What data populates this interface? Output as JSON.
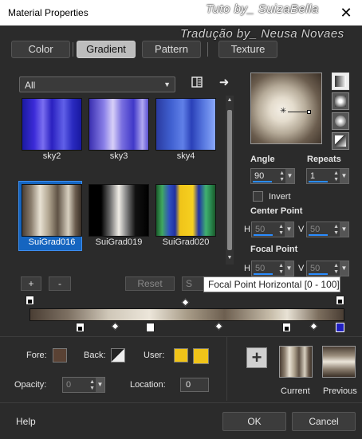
{
  "window": {
    "title": "Material Properties",
    "watermark_1": "Tuto by_ SuizaBella",
    "watermark_2": "Tradução by_ Neusa Novaes",
    "close_glyph": "✕"
  },
  "tabs": [
    "Color",
    "Gradient",
    "Pattern",
    "Texture"
  ],
  "active_tab": "Gradient",
  "category_dropdown": {
    "value": "All"
  },
  "gallery": {
    "items": [
      {
        "label": "sky2",
        "selected": false
      },
      {
        "label": "sky3",
        "selected": false
      },
      {
        "label": "sky4",
        "selected": false
      },
      {
        "label": "SuiGrad016",
        "selected": true
      },
      {
        "label": "SuiGrad019",
        "selected": false
      },
      {
        "label": "SuiGrad020",
        "selected": false
      }
    ]
  },
  "angle": {
    "label": "Angle",
    "value": "90"
  },
  "repeats": {
    "label": "Repeats",
    "value": "1"
  },
  "invert": {
    "label": "Invert",
    "checked": false
  },
  "center_point": {
    "label": "Center Point",
    "h_label": "H",
    "h_value": "50",
    "v_label": "V",
    "v_value": "50"
  },
  "focal_point": {
    "label": "Focal Point",
    "h_label": "H",
    "h_value": "50",
    "v_label": "V",
    "v_value": "50"
  },
  "editor_buttons": {
    "add": "+",
    "remove": "-",
    "reset": "Reset",
    "s_partial": "S"
  },
  "tooltip": "Focal Point Horizontal [0 - 100]",
  "fore": {
    "label": "Fore:",
    "color": "#5a4234"
  },
  "back": {
    "label": "Back:"
  },
  "user": {
    "label": "User:",
    "color": "#f0c419"
  },
  "opacity": {
    "label": "Opacity:",
    "value": "0"
  },
  "location": {
    "label": "Location:",
    "value": "0"
  },
  "current_label": "Current",
  "previous_label": "Previous",
  "footer": {
    "help": "Help",
    "ok": "OK",
    "cancel": "Cancel"
  },
  "colors": {
    "accent": "#1565c0",
    "selected_marker": "#2020c0",
    "user_yellow": "#f0c419"
  }
}
